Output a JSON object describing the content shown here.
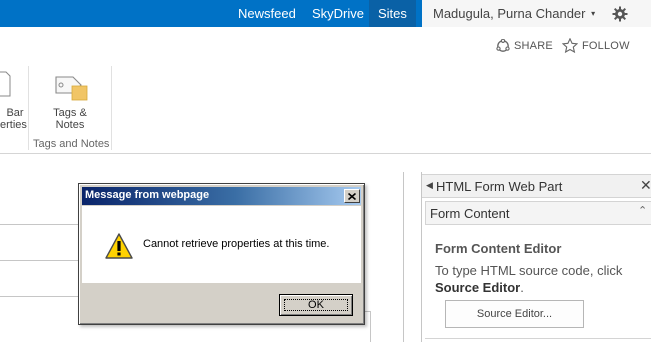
{
  "suite_bar": {
    "links": [
      "Newsfeed",
      "SkyDrive",
      "Sites"
    ],
    "user_name": "Madugula, Purna Chander",
    "user_caret": "▾",
    "settings_icon": "gear-icon",
    "brand_color": "#0072c6"
  },
  "share_bar": {
    "share_label": "SHARE",
    "follow_label": "FOLLOW"
  },
  "ribbon": {
    "prev_button_lines": [
      "Bar",
      "erties"
    ],
    "tags_button_lines": [
      "Tags &",
      "Notes"
    ],
    "group_label": "Tags and Notes"
  },
  "web_part": {
    "header_title": "HTML Form Web Part",
    "section_label": "Form Content",
    "editor_title": "Form Content Editor",
    "editor_desc_prefix": "To type HTML source code, click",
    "editor_desc_link": "Source Editor",
    "editor_desc_suffix": ".",
    "editor_button": "Source Editor..."
  },
  "dialog": {
    "title": "Message from webpage",
    "message": "Cannot retrieve properties at this time.",
    "ok_label": "OK",
    "close_symbol": "X"
  }
}
